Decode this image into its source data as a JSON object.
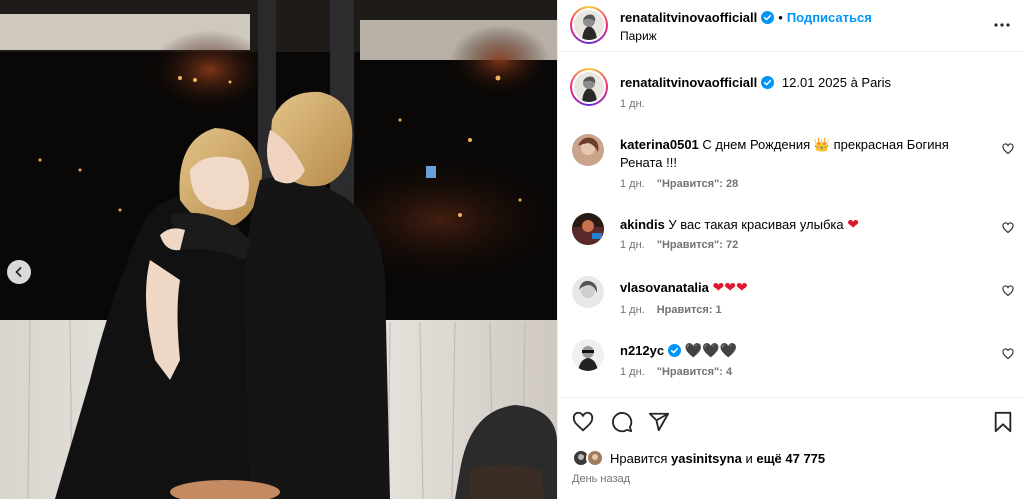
{
  "post": {
    "author": "renatalitvinovaofficiall",
    "follow_label": "Подписаться",
    "separator": "•",
    "location": "Париж",
    "more_icon": "more-horizontal-icon",
    "caption_text": "12.01 2025 à Paris",
    "caption_time": "1 дн."
  },
  "comments": [
    {
      "user": "katerina0501",
      "text_a": "С днем Рождения",
      "emoji": "👑",
      "text_b": "прекрасная Богиня Рената !!!",
      "time": "1 дн.",
      "likes": "\"Нравится\": 28"
    },
    {
      "user": "akindis",
      "text_a": "У вас такая красивая улыбка",
      "emoji": "❤",
      "time": "1 дн.",
      "likes": "\"Нравится\": 72"
    },
    {
      "user": "vlasovanatalia",
      "text_a": "",
      "emoji": "❤❤❤",
      "time": "1 дн.",
      "likes": "Нравится: 1"
    },
    {
      "user": "n212yc",
      "text_a": "",
      "emoji": "🖤🖤🖤",
      "time": "1 дн.",
      "likes": "\"Нравится\": 4"
    }
  ],
  "footer": {
    "likes_prefix": "Нравится",
    "likes_user": "yasinitsyna",
    "likes_mid": "и",
    "likes_count": "ещё 47 775",
    "post_time": "День назад"
  },
  "colors": {
    "accent": "#0095f6",
    "heart": "#e0182d",
    "muted": "#737373",
    "border": "#efefef"
  },
  "icons": [
    "heart-icon",
    "comment-icon",
    "share-icon",
    "bookmark-icon",
    "verified-icon",
    "chevron-left-icon"
  ]
}
